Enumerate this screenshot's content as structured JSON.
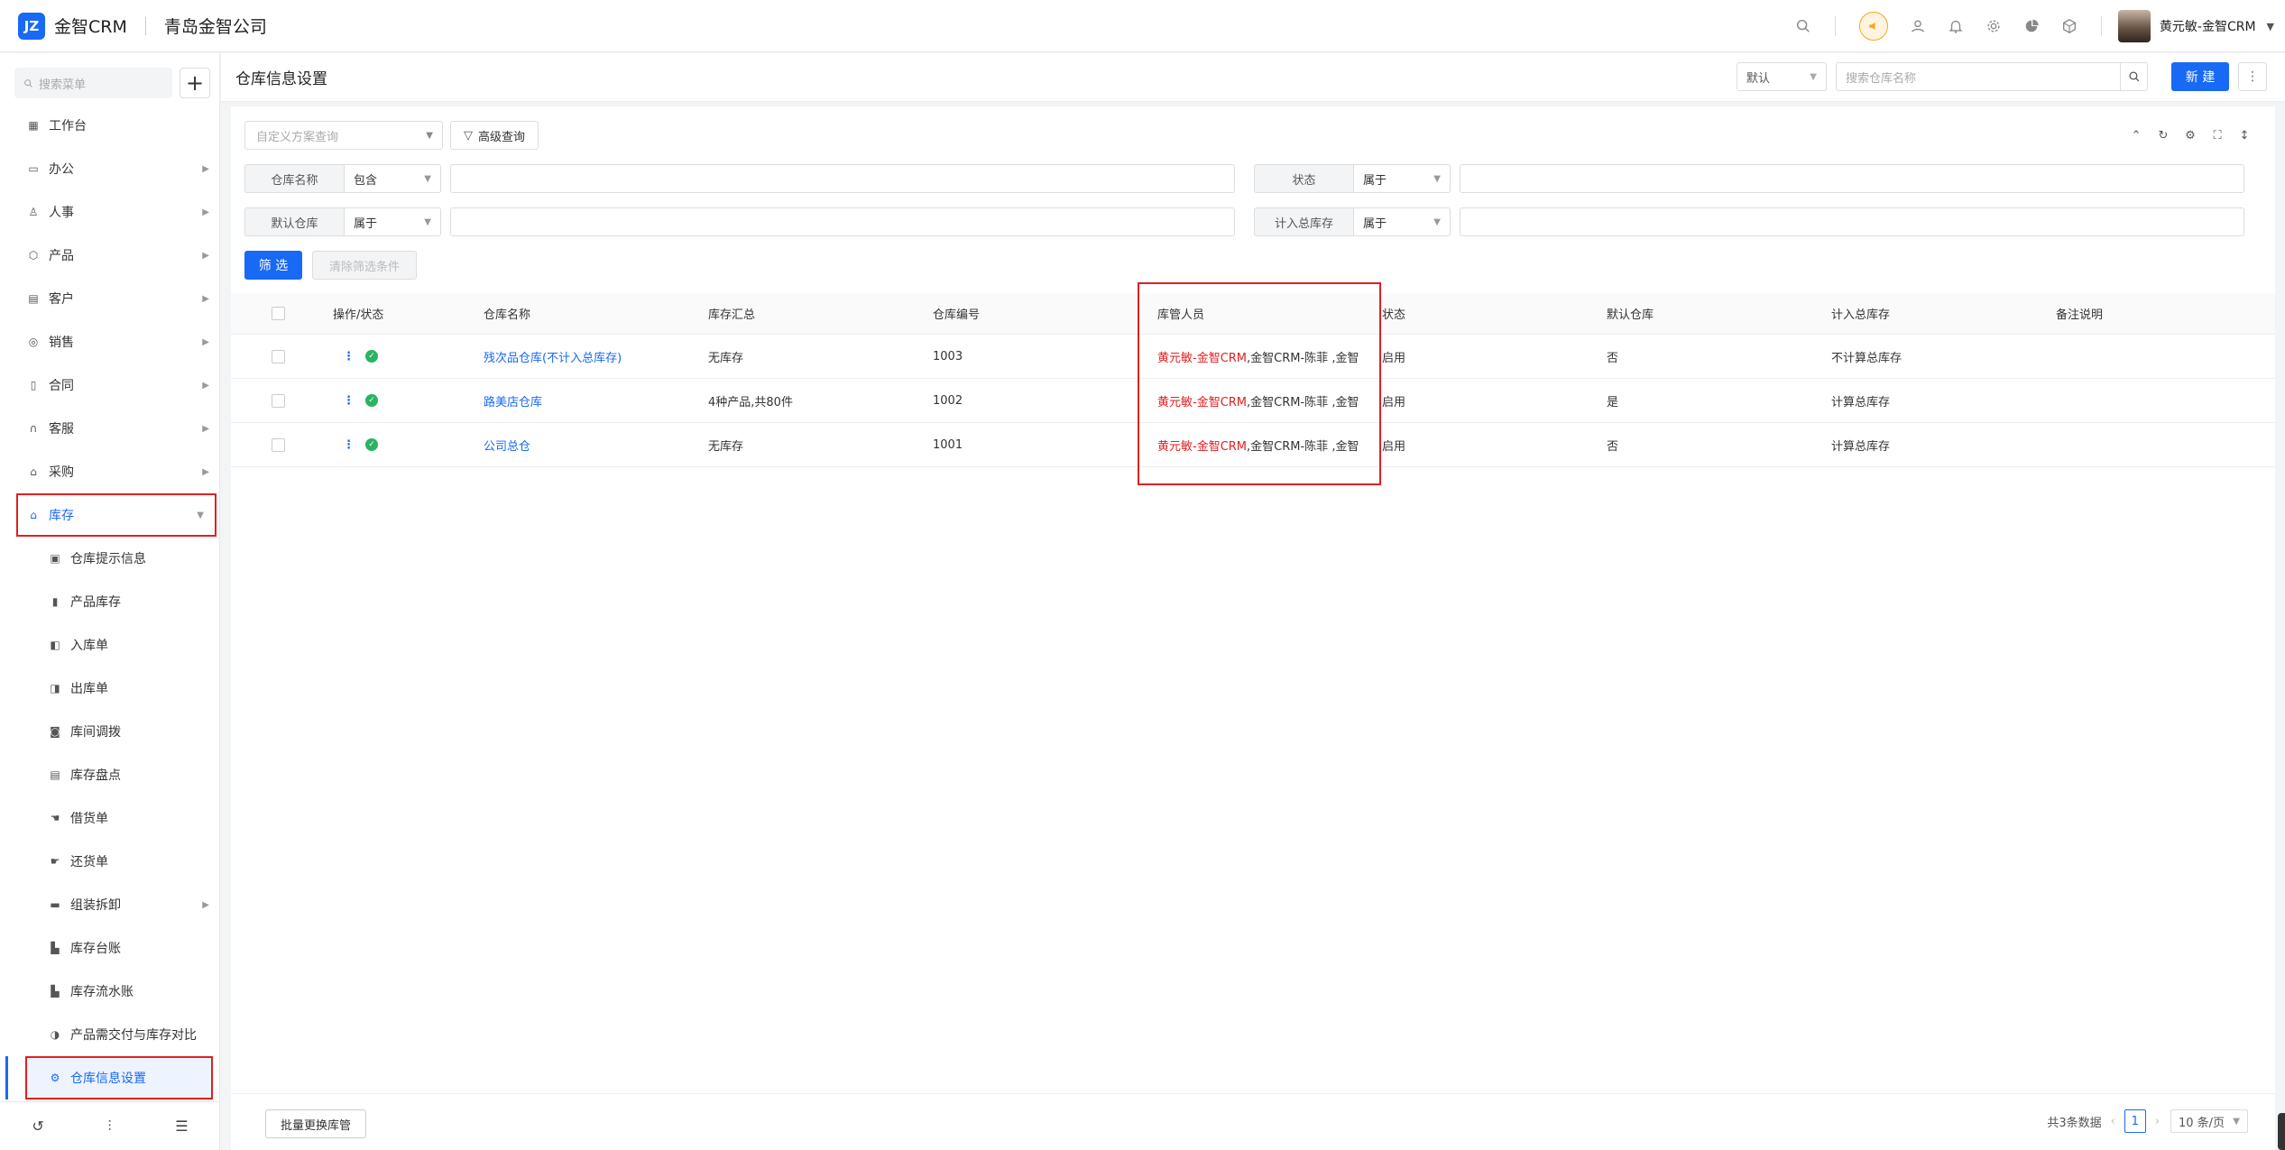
{
  "app": {
    "logo_text": "金智CRM",
    "company": "青岛金智公司",
    "user_name": "黄元敏-金智CRM"
  },
  "sidebar": {
    "search_placeholder": "搜索菜单",
    "items": [
      {
        "label": "工作台",
        "icon": "dashboard-icon",
        "arrow": false
      },
      {
        "label": "办公",
        "icon": "office-icon",
        "arrow": true
      },
      {
        "label": "人事",
        "icon": "people-icon",
        "arrow": true
      },
      {
        "label": "产品",
        "icon": "cube-icon",
        "arrow": true
      },
      {
        "label": "客户",
        "icon": "customer-icon",
        "arrow": true
      },
      {
        "label": "销售",
        "icon": "sales-icon",
        "arrow": true
      },
      {
        "label": "合同",
        "icon": "contract-icon",
        "arrow": true
      },
      {
        "label": "客服",
        "icon": "headset-icon",
        "arrow": true
      },
      {
        "label": "采购",
        "icon": "cart-icon",
        "arrow": true
      },
      {
        "label": "库存",
        "icon": "warehouse-icon",
        "arrow": true
      }
    ],
    "sub_items": [
      {
        "label": "仓库提示信息",
        "icon": "info-icon"
      },
      {
        "label": "产品库存",
        "icon": "file-icon"
      },
      {
        "label": "入库单",
        "icon": "inbound-icon"
      },
      {
        "label": "出库单",
        "icon": "outbound-icon"
      },
      {
        "label": "库间调拨",
        "icon": "transfer-icon"
      },
      {
        "label": "库存盘点",
        "icon": "stocktake-icon"
      },
      {
        "label": "借货单",
        "icon": "borrow-icon"
      },
      {
        "label": "还货单",
        "icon": "return-icon"
      },
      {
        "label": "组装拆卸",
        "icon": "assembly-icon",
        "arrow": true
      },
      {
        "label": "库存台账",
        "icon": "ledger-icon"
      },
      {
        "label": "库存流水账",
        "icon": "journal-icon"
      },
      {
        "label": "产品需交付与库存对比",
        "icon": "compare-icon"
      },
      {
        "label": "仓库信息设置",
        "icon": "gear-icon"
      }
    ]
  },
  "header": {
    "title": "仓库信息设置",
    "view_select": "默认",
    "search_placeholder": "搜索仓库名称",
    "new_label": "新 建"
  },
  "filters": {
    "scheme_placeholder": "自定义方案查询",
    "advanced_label": "高级查询",
    "rows": [
      {
        "label": "仓库名称",
        "op": "包含"
      },
      {
        "label": "状态",
        "op": "属于"
      },
      {
        "label": "默认仓库",
        "op": "属于"
      },
      {
        "label": "计入总库存",
        "op": "属于"
      }
    ],
    "filter_btn": "筛 选",
    "clear_btn": "清除筛选条件"
  },
  "table": {
    "columns": [
      "操作/状态",
      "仓库名称",
      "库存汇总",
      "仓库编号",
      "库管人员",
      "状态",
      "默认仓库",
      "计入总库存",
      "备注说明"
    ],
    "rows": [
      {
        "name": "残次品仓库(不计入总库存)",
        "summary": "无库存",
        "code": "1003",
        "manager_hl": "黄元敏-金智CRM",
        "manager_rest": ",金智CRM-陈菲 ,金智",
        "status": "启用",
        "default": "否",
        "count_total": "不计算总库存",
        "remark": ""
      },
      {
        "name": "路美店仓库",
        "summary": "4种产品,共80件",
        "code": "1002",
        "manager_hl": "黄元敏-金智CRM",
        "manager_rest": ",金智CRM-陈菲 ,金智",
        "status": "启用",
        "default": "是",
        "count_total": "计算总库存",
        "remark": ""
      },
      {
        "name": "公司总仓",
        "summary": "无库存",
        "code": "1001",
        "manager_hl": "黄元敏-金智CRM",
        "manager_rest": ",金智CRM-陈菲 ,金智",
        "status": "启用",
        "default": "否",
        "count_total": "计算总库存",
        "remark": ""
      }
    ]
  },
  "footer": {
    "batch_label": "批量更换库管",
    "total_text": "共3条数据",
    "page": "1",
    "page_size": "10 条/页"
  },
  "colors": {
    "accent": "#1869f5",
    "highlight": "#e02020",
    "ok": "#28b463"
  }
}
